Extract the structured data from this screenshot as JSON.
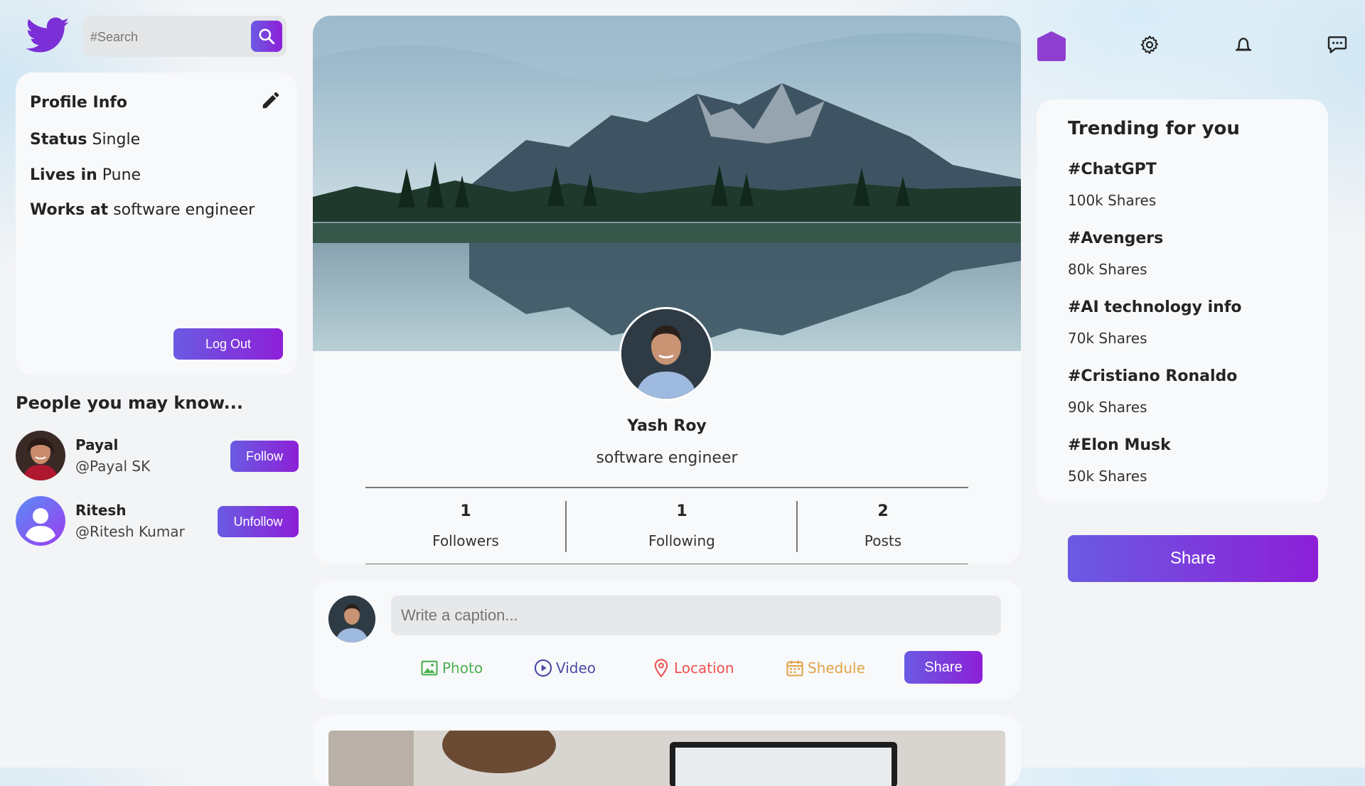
{
  "search": {
    "placeholder": "#Search"
  },
  "profile_info": {
    "title": "Profile Info",
    "rows": [
      {
        "label": "Status",
        "value": "Single"
      },
      {
        "label": "Lives in",
        "value": "Pune"
      },
      {
        "label": "Works at",
        "value": "software engineer"
      }
    ],
    "logout_label": "Log Out"
  },
  "people": {
    "title": "People you may know...",
    "items": [
      {
        "name": "Payal",
        "handle": "@Payal SK",
        "button": "Follow"
      },
      {
        "name": "Ritesh",
        "handle": "@Ritesh Kumar",
        "button": "Unfollow"
      }
    ]
  },
  "profile": {
    "name": "Yash Roy",
    "job": "software engineer",
    "stats": [
      {
        "value": "1",
        "label": "Followers"
      },
      {
        "value": "1",
        "label": "Following"
      },
      {
        "value": "2",
        "label": "Posts"
      }
    ]
  },
  "composer": {
    "placeholder": "Write a caption...",
    "options": [
      {
        "label": "Photo",
        "icon": "image-icon",
        "color": "#4caf50"
      },
      {
        "label": "Video",
        "icon": "play-circle-icon",
        "color": "#4a4aa8"
      },
      {
        "label": "Location",
        "icon": "location-pin-icon",
        "color": "#ef5350"
      },
      {
        "label": "Shedule",
        "icon": "calendar-icon",
        "color": "#e1a449"
      }
    ],
    "share_label": "Share"
  },
  "header_icons": [
    "home-icon",
    "gear-icon",
    "notification-bell-icon",
    "chat-icon"
  ],
  "trending": {
    "title": "Trending for you",
    "items": [
      {
        "tag": "#ChatGPT",
        "shares": "100k Shares"
      },
      {
        "tag": "#Avengers",
        "shares": "80k Shares"
      },
      {
        "tag": "#AI technology info",
        "shares": "70k Shares"
      },
      {
        "tag": "#Cristiano Ronaldo",
        "shares": "90k Shares"
      },
      {
        "tag": "#Elon Musk",
        "shares": "50k Shares"
      }
    ]
  },
  "share_button_label": "Share",
  "colors": {
    "accent_start": "#6a5be2",
    "accent_end": "#8d1fd7"
  }
}
